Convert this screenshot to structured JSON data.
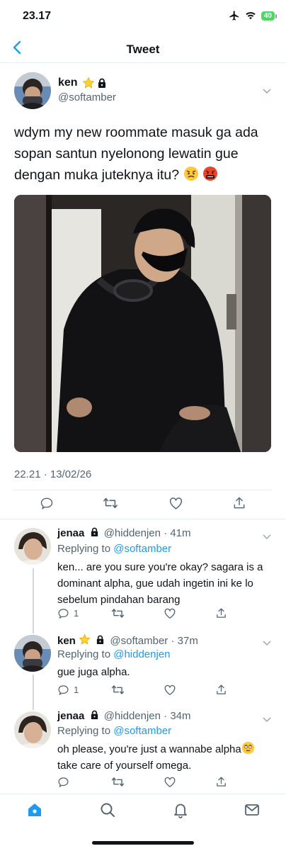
{
  "status_bar": {
    "time": "23.17",
    "battery": "40"
  },
  "nav": {
    "title": "Tweet"
  },
  "tweet": {
    "author_name": "ken",
    "author_handle": "@softamber",
    "text": "wdym my new roommate masuk ga ada sopan santun nyelonong lewatin gue dengan muka juteknya itu?",
    "timestamp": "22.21 · 13/02/26"
  },
  "replies": [
    {
      "name": "jenaa",
      "handle": "@hiddenjen",
      "time": "· 41m",
      "replying_prefix": "Replying to",
      "replying_to": "@softamber",
      "text": "ken... are you sure you're okay? sagara is a dominant alpha, gue udah ingetin ini ke lo sebelum pindahan barang",
      "reply_count": "1"
    },
    {
      "name": "ken",
      "handle": "@softamber",
      "time": "· 37m",
      "replying_prefix": "Replying to",
      "replying_to": "@hiddenjen",
      "text": "gue juga alpha.",
      "reply_count": "1"
    },
    {
      "name": "jenaa",
      "handle": "@hiddenjen",
      "time": "· 34m",
      "replying_prefix": "Replying to",
      "replying_to": "@softamber",
      "text_line1": "oh please, you're just a wannabe alpha",
      "text_line2": "take care of yourself omega.",
      "reply_count": ""
    }
  ],
  "icons": {
    "back": "chevron-left-icon",
    "caret": "chevron-down-icon",
    "lock": "lock-icon",
    "star": "star-icon",
    "reply": "reply-icon",
    "retweet": "retweet-icon",
    "like": "heart-icon",
    "share": "share-icon",
    "home": "home-icon",
    "search": "search-icon",
    "notifications": "bell-icon",
    "messages": "mail-icon"
  },
  "colors": {
    "accent": "#1d9bf0",
    "text": "#0f1419",
    "muted": "#536471",
    "divider": "#e6ecf0"
  }
}
